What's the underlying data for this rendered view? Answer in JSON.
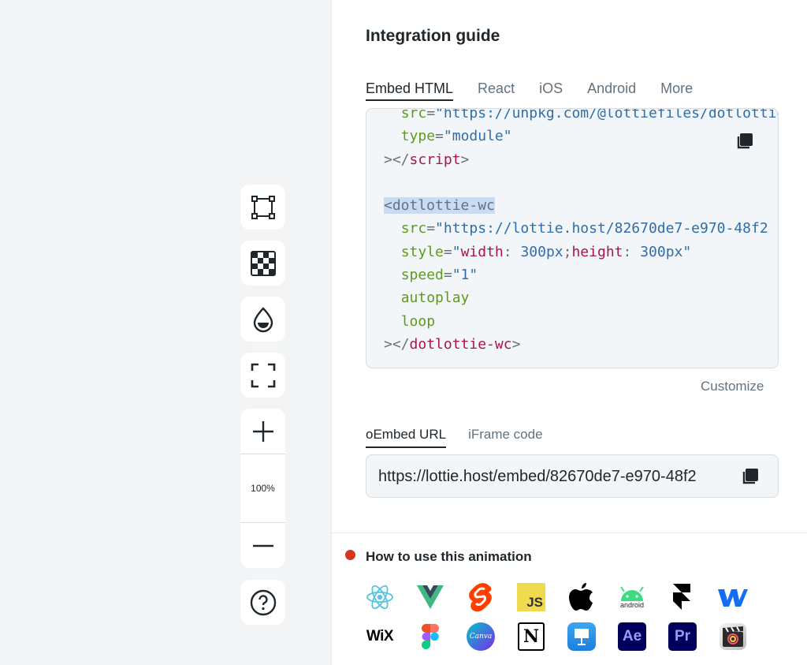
{
  "toolbar": {
    "items": [
      {
        "name": "bounding-box-icon"
      },
      {
        "name": "transparency-grid-icon"
      },
      {
        "name": "background-color-icon"
      },
      {
        "name": "fullscreen-icon"
      }
    ],
    "zoom_level": "100%",
    "zoom_in_icon": "plus-icon",
    "zoom_out_icon": "minus-icon",
    "help_icon": "help-icon"
  },
  "panel": {
    "title": "Integration guide",
    "tabs": [
      {
        "label": "Embed HTML",
        "active": true
      },
      {
        "label": "React",
        "active": false
      },
      {
        "label": "iOS",
        "active": false
      },
      {
        "label": "Android",
        "active": false
      },
      {
        "label": "More",
        "active": false
      }
    ],
    "code": {
      "lines": [
        {
          "indent": "  ",
          "parts": [
            [
              "attr",
              "src"
            ],
            [
              "punc",
              "="
            ],
            [
              "str",
              "\"https://unpkg.com/@lottiefiles/dotlottie-wc"
            ]
          ]
        },
        {
          "indent": "  ",
          "parts": [
            [
              "attr",
              "type"
            ],
            [
              "punc",
              "="
            ],
            [
              "str",
              "\"module\""
            ]
          ]
        },
        {
          "indent": "",
          "parts": [
            [
              "punc",
              "></"
            ],
            [
              "tag",
              "script"
            ],
            [
              "punc",
              ">"
            ]
          ]
        },
        {
          "indent": "",
          "parts": []
        },
        {
          "indent": "",
          "parts": [
            [
              "hl",
              "<dotlottie-wc"
            ]
          ]
        },
        {
          "indent": "  ",
          "parts": [
            [
              "attr",
              "src"
            ],
            [
              "punc",
              "="
            ],
            [
              "str",
              "\"https://lottie.host/82670de7-e970-48f2"
            ]
          ]
        },
        {
          "indent": "  ",
          "parts": [
            [
              "attr",
              "style"
            ],
            [
              "punc",
              "="
            ],
            [
              "str",
              "\""
            ],
            [
              "tag",
              "width"
            ],
            [
              "punc",
              ": "
            ],
            [
              "str",
              "300px"
            ],
            [
              "punc",
              ";"
            ],
            [
              "tag",
              "height"
            ],
            [
              "punc",
              ": "
            ],
            [
              "str",
              "300px\""
            ]
          ]
        },
        {
          "indent": "  ",
          "parts": [
            [
              "attr",
              "speed"
            ],
            [
              "punc",
              "="
            ],
            [
              "str",
              "\"1\""
            ]
          ]
        },
        {
          "indent": "  ",
          "parts": [
            [
              "attr",
              "autoplay"
            ]
          ]
        },
        {
          "indent": "  ",
          "parts": [
            [
              "attr",
              "loop"
            ]
          ]
        },
        {
          "indent": "",
          "parts": [
            [
              "punc",
              "></"
            ],
            [
              "tag",
              "dotlottie-wc"
            ],
            [
              "punc",
              ">"
            ]
          ]
        }
      ]
    },
    "customize_label": "Customize",
    "embed_tabs": [
      {
        "label": "oEmbed URL",
        "active": true
      },
      {
        "label": "iFrame code",
        "active": false
      }
    ],
    "embed_url": "https://lottie.host/embed/82670de7-e970-48f2",
    "copy_icon": "copy-icon"
  },
  "howto": {
    "title": "How to use this animation",
    "status_color": "#d2381c",
    "integrations": [
      {
        "name": "react"
      },
      {
        "name": "vue"
      },
      {
        "name": "svelte"
      },
      {
        "name": "javascript",
        "text": "JS"
      },
      {
        "name": "apple"
      },
      {
        "name": "android",
        "text": "android"
      },
      {
        "name": "framer"
      },
      {
        "name": "webflow"
      },
      {
        "name": "wix",
        "text": "WiX"
      },
      {
        "name": "figma"
      },
      {
        "name": "canva",
        "text": "Canva"
      },
      {
        "name": "notion",
        "text": "N"
      },
      {
        "name": "keynote"
      },
      {
        "name": "after-effects",
        "text": "Ae"
      },
      {
        "name": "premiere-pro",
        "text": "Pr"
      },
      {
        "name": "final-cut-pro"
      }
    ]
  }
}
